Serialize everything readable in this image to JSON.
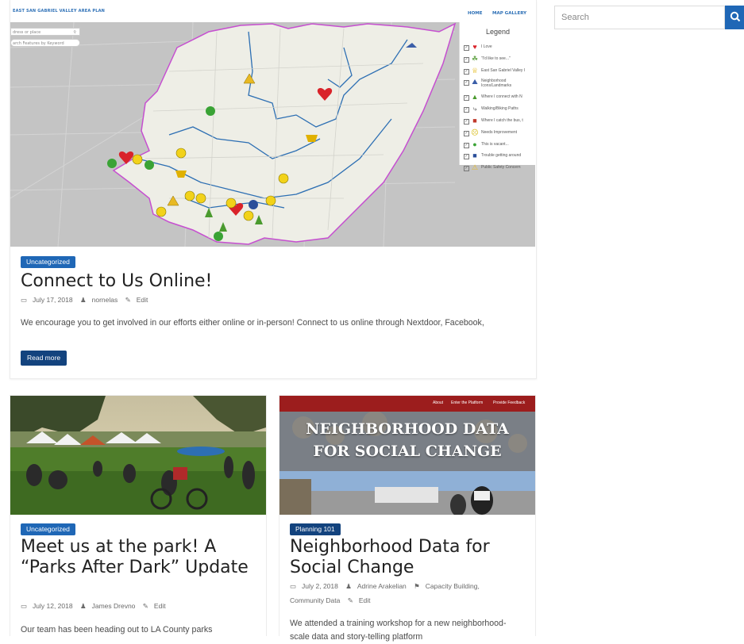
{
  "featured": {
    "map": {
      "site_title": "EAST SAN GABRIEL VALLEY AREA PLAN",
      "nav": [
        "HOME",
        "MAP GALLERY"
      ],
      "search_placeholder": "dress or place",
      "filter_placeholder": "arch Features by Keyword",
      "legend_title": "Legend",
      "legend_items": [
        {
          "label": "I Love",
          "icon": "heart-icon",
          "color": "#d9232a"
        },
        {
          "label": "\"I'd like to see...\"",
          "icon": "sprout-icon",
          "color": "#6aa84f"
        },
        {
          "label": "East San Gabriel Valley I",
          "icon": "crown-icon",
          "color": "#e0b100"
        },
        {
          "label": "Neighborhood Icons/Landmarks",
          "icon": "landmark-icon",
          "color": "#3b5ea8"
        },
        {
          "label": "Where I connect with N",
          "icon": "tree-icon",
          "color": "#4a9a2e"
        },
        {
          "label": "Walking/Biking Paths",
          "icon": "walk-icon",
          "color": "#555555"
        },
        {
          "label": "Where I catch the bus, t",
          "icon": "bus-icon",
          "color": "#c0392b"
        },
        {
          "label": "Needs Improvement",
          "icon": "frown-icon",
          "color": "#f2d21a"
        },
        {
          "label": "This is vacant...",
          "icon": "question-icon",
          "color": "#3aa335"
        },
        {
          "label": "Trouble getting around",
          "icon": "car-icon",
          "color": "#2b4f9a"
        },
        {
          "label": "Public Safety Concern",
          "icon": "warning-icon",
          "color": "#e8b923"
        }
      ]
    },
    "category": "Uncategorized",
    "title": "Connect to Us Online!",
    "date": "July 17, 2018",
    "author": "nornelas",
    "edit": "Edit",
    "excerpt": "We encourage you to get involved in our efforts either online or in-person! Connect to us online through Nextdoor, Facebook,",
    "read_more": "Read more"
  },
  "post2": {
    "category": "Uncategorized",
    "title": "Meet us at the park! A “Parks After Dark” Update",
    "date": "July 12, 2018",
    "author": "James Drevno",
    "edit": "Edit",
    "excerpt": "Our team has been heading out to LA County parks"
  },
  "post3": {
    "image_nav": [
      "About",
      "Enter the Platform",
      "Provide Feedback"
    ],
    "image_heading_line1": "NEIGHBORHOOD DATA",
    "image_heading_line2": "FOR SOCIAL CHANGE",
    "category": "Planning 101",
    "title": "Neighborhood Data for Social Change",
    "date": "July 2, 2018",
    "author": "Adrine Arakelian",
    "tags": "Capacity Building,",
    "tags2": "Community Data",
    "edit": "Edit",
    "excerpt": "We attended a training workshop for a new neighborhood-scale data and story-telling platform"
  },
  "sidebar": {
    "search_placeholder": "Search",
    "search_icon": "search-icon"
  },
  "colors": {
    "accent": "#1f67b6",
    "dark_accent": "#13437e",
    "map_boundary": "#2d6fb3",
    "area_outline": "#c64fd0"
  }
}
